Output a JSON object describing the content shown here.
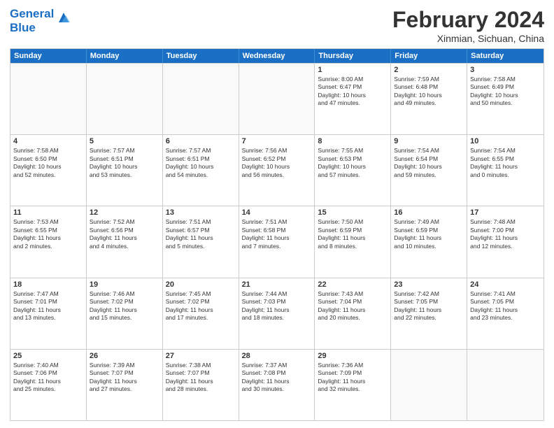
{
  "logo": {
    "line1": "General",
    "line2": "Blue"
  },
  "title": "February 2024",
  "subtitle": "Xinmian, Sichuan, China",
  "headers": [
    "Sunday",
    "Monday",
    "Tuesday",
    "Wednesday",
    "Thursday",
    "Friday",
    "Saturday"
  ],
  "rows": [
    [
      {
        "day": "",
        "lines": []
      },
      {
        "day": "",
        "lines": []
      },
      {
        "day": "",
        "lines": []
      },
      {
        "day": "",
        "lines": []
      },
      {
        "day": "1",
        "lines": [
          "Sunrise: 8:00 AM",
          "Sunset: 6:47 PM",
          "Daylight: 10 hours",
          "and 47 minutes."
        ]
      },
      {
        "day": "2",
        "lines": [
          "Sunrise: 7:59 AM",
          "Sunset: 6:48 PM",
          "Daylight: 10 hours",
          "and 49 minutes."
        ]
      },
      {
        "day": "3",
        "lines": [
          "Sunrise: 7:58 AM",
          "Sunset: 6:49 PM",
          "Daylight: 10 hours",
          "and 50 minutes."
        ]
      }
    ],
    [
      {
        "day": "4",
        "lines": [
          "Sunrise: 7:58 AM",
          "Sunset: 6:50 PM",
          "Daylight: 10 hours",
          "and 52 minutes."
        ]
      },
      {
        "day": "5",
        "lines": [
          "Sunrise: 7:57 AM",
          "Sunset: 6:51 PM",
          "Daylight: 10 hours",
          "and 53 minutes."
        ]
      },
      {
        "day": "6",
        "lines": [
          "Sunrise: 7:57 AM",
          "Sunset: 6:51 PM",
          "Daylight: 10 hours",
          "and 54 minutes."
        ]
      },
      {
        "day": "7",
        "lines": [
          "Sunrise: 7:56 AM",
          "Sunset: 6:52 PM",
          "Daylight: 10 hours",
          "and 56 minutes."
        ]
      },
      {
        "day": "8",
        "lines": [
          "Sunrise: 7:55 AM",
          "Sunset: 6:53 PM",
          "Daylight: 10 hours",
          "and 57 minutes."
        ]
      },
      {
        "day": "9",
        "lines": [
          "Sunrise: 7:54 AM",
          "Sunset: 6:54 PM",
          "Daylight: 10 hours",
          "and 59 minutes."
        ]
      },
      {
        "day": "10",
        "lines": [
          "Sunrise: 7:54 AM",
          "Sunset: 6:55 PM",
          "Daylight: 11 hours",
          "and 0 minutes."
        ]
      }
    ],
    [
      {
        "day": "11",
        "lines": [
          "Sunrise: 7:53 AM",
          "Sunset: 6:55 PM",
          "Daylight: 11 hours",
          "and 2 minutes."
        ]
      },
      {
        "day": "12",
        "lines": [
          "Sunrise: 7:52 AM",
          "Sunset: 6:56 PM",
          "Daylight: 11 hours",
          "and 4 minutes."
        ]
      },
      {
        "day": "13",
        "lines": [
          "Sunrise: 7:51 AM",
          "Sunset: 6:57 PM",
          "Daylight: 11 hours",
          "and 5 minutes."
        ]
      },
      {
        "day": "14",
        "lines": [
          "Sunrise: 7:51 AM",
          "Sunset: 6:58 PM",
          "Daylight: 11 hours",
          "and 7 minutes."
        ]
      },
      {
        "day": "15",
        "lines": [
          "Sunrise: 7:50 AM",
          "Sunset: 6:59 PM",
          "Daylight: 11 hours",
          "and 8 minutes."
        ]
      },
      {
        "day": "16",
        "lines": [
          "Sunrise: 7:49 AM",
          "Sunset: 6:59 PM",
          "Daylight: 11 hours",
          "and 10 minutes."
        ]
      },
      {
        "day": "17",
        "lines": [
          "Sunrise: 7:48 AM",
          "Sunset: 7:00 PM",
          "Daylight: 11 hours",
          "and 12 minutes."
        ]
      }
    ],
    [
      {
        "day": "18",
        "lines": [
          "Sunrise: 7:47 AM",
          "Sunset: 7:01 PM",
          "Daylight: 11 hours",
          "and 13 minutes."
        ]
      },
      {
        "day": "19",
        "lines": [
          "Sunrise: 7:46 AM",
          "Sunset: 7:02 PM",
          "Daylight: 11 hours",
          "and 15 minutes."
        ]
      },
      {
        "day": "20",
        "lines": [
          "Sunrise: 7:45 AM",
          "Sunset: 7:02 PM",
          "Daylight: 11 hours",
          "and 17 minutes."
        ]
      },
      {
        "day": "21",
        "lines": [
          "Sunrise: 7:44 AM",
          "Sunset: 7:03 PM",
          "Daylight: 11 hours",
          "and 18 minutes."
        ]
      },
      {
        "day": "22",
        "lines": [
          "Sunrise: 7:43 AM",
          "Sunset: 7:04 PM",
          "Daylight: 11 hours",
          "and 20 minutes."
        ]
      },
      {
        "day": "23",
        "lines": [
          "Sunrise: 7:42 AM",
          "Sunset: 7:05 PM",
          "Daylight: 11 hours",
          "and 22 minutes."
        ]
      },
      {
        "day": "24",
        "lines": [
          "Sunrise: 7:41 AM",
          "Sunset: 7:05 PM",
          "Daylight: 11 hours",
          "and 23 minutes."
        ]
      }
    ],
    [
      {
        "day": "25",
        "lines": [
          "Sunrise: 7:40 AM",
          "Sunset: 7:06 PM",
          "Daylight: 11 hours",
          "and 25 minutes."
        ]
      },
      {
        "day": "26",
        "lines": [
          "Sunrise: 7:39 AM",
          "Sunset: 7:07 PM",
          "Daylight: 11 hours",
          "and 27 minutes."
        ]
      },
      {
        "day": "27",
        "lines": [
          "Sunrise: 7:38 AM",
          "Sunset: 7:07 PM",
          "Daylight: 11 hours",
          "and 28 minutes."
        ]
      },
      {
        "day": "28",
        "lines": [
          "Sunrise: 7:37 AM",
          "Sunset: 7:08 PM",
          "Daylight: 11 hours",
          "and 30 minutes."
        ]
      },
      {
        "day": "29",
        "lines": [
          "Sunrise: 7:36 AM",
          "Sunset: 7:09 PM",
          "Daylight: 11 hours",
          "and 32 minutes."
        ]
      },
      {
        "day": "",
        "lines": []
      },
      {
        "day": "",
        "lines": []
      }
    ]
  ]
}
